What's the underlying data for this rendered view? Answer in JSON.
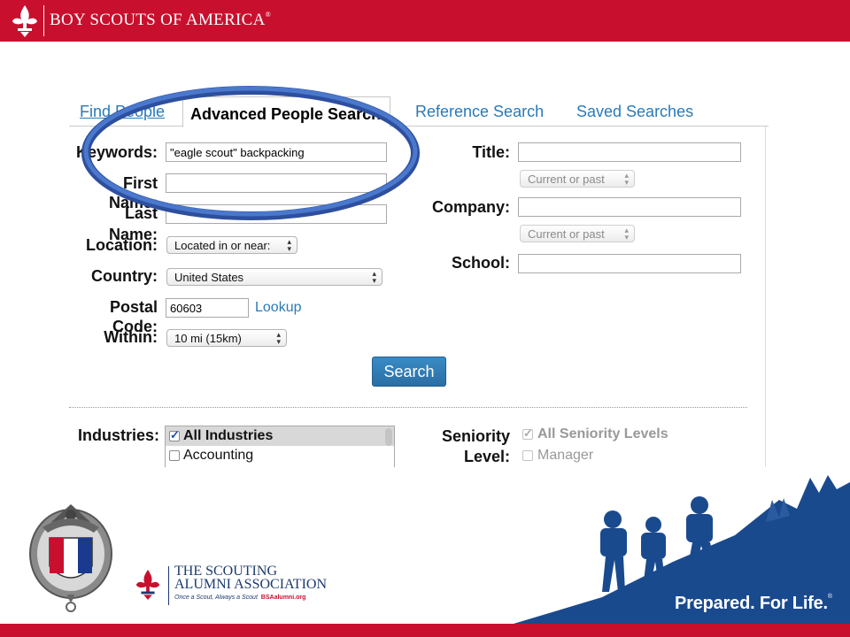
{
  "header": {
    "org_name": "BOY SCOUTS OF AMERICA",
    "reg_mark": "®"
  },
  "tabs": [
    {
      "label": "Find People"
    },
    {
      "label": "Advanced People Search"
    },
    {
      "label": "Reference Search"
    },
    {
      "label": "Saved Searches"
    }
  ],
  "form": {
    "keywords_label": "Keywords:",
    "keywords_value": "\"eagle scout\" backpacking",
    "first_name_label_1": "First",
    "first_name_label_2": "Name:",
    "last_name_label_1": "Last",
    "last_name_label_2": "Name:",
    "location_label": "Location:",
    "location_value": "Located in or near:",
    "country_label": "Country:",
    "country_value": "United States",
    "postal_label_1": "Postal",
    "postal_label_2": "Code:",
    "postal_value": "60603",
    "lookup_label": "Lookup",
    "within_label": "Within:",
    "within_value": "10 mi (15km)",
    "title_label": "Title:",
    "title_scope": "Current or past",
    "company_label": "Company:",
    "company_scope": "Current or past",
    "school_label": "School:",
    "search_button": "Search"
  },
  "filters": {
    "industries_label": "Industries:",
    "industries": [
      {
        "label": "All Industries",
        "checked": true
      },
      {
        "label": "Accounting",
        "checked": false
      }
    ],
    "seniority_label_1": "Seniority",
    "seniority_label_2": "Level:",
    "seniority": [
      {
        "label": "All Seniority Levels",
        "checked": true
      },
      {
        "label": "Manager",
        "checked": false
      }
    ]
  },
  "footer": {
    "eagle_logo": "NATIONAL EAGLE SCOUT ASSOCIATION",
    "alumni_line1": "THE SCOUTING",
    "alumni_line2": "ALUMNI ASSOCIATION",
    "alumni_tag": "Once a Scout, Always a Scout",
    "alumni_site": "BSAalumni.org",
    "tagline": "Prepared. For Life.",
    "tagline_mark": "®"
  },
  "colors": {
    "brand_red": "#c8102e",
    "link_blue": "#2a7ab8",
    "annotation_blue": "#3a63b8",
    "scene_blue": "#1a4a8e"
  }
}
